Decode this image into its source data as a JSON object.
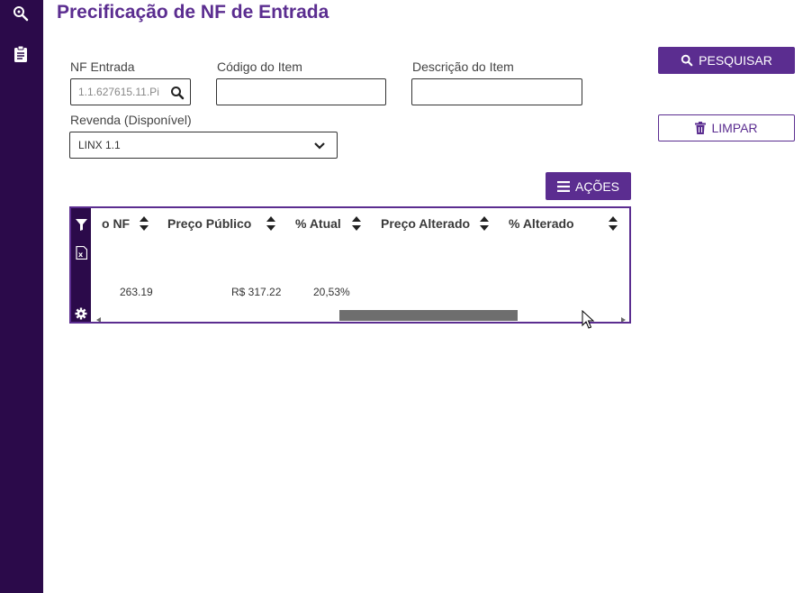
{
  "app": {
    "title": "Precificação de NF de Entrada",
    "colors": {
      "sidebar": "#2b0a4a",
      "accent": "#5b2d90"
    }
  },
  "sidebar": {
    "icons": [
      {
        "name": "search-icon"
      },
      {
        "name": "clipboard-icon"
      }
    ]
  },
  "filters": {
    "nf_entrada": {
      "label": "NF Entrada",
      "value": "1.1.627615.11.Pi"
    },
    "codigo_item": {
      "label": "Código do Item",
      "value": ""
    },
    "descricao_item": {
      "label": "Descrição do Item",
      "value": ""
    },
    "revenda": {
      "label": "Revenda (Disponível)",
      "selected": "LINX 1.1"
    }
  },
  "actions": {
    "pesquisar": "PESQUISAR",
    "limpar": "LIMPAR",
    "acoes": "AÇÕES"
  },
  "grid": {
    "columns": [
      "o NF",
      "Preço Público",
      "% Atual",
      "Preço Alterado",
      "% Alterado"
    ],
    "rows": [
      {
        "nf": "263.19",
        "preco_publico": "R$ 317.22",
        "pct_atual": "20,53%",
        "preco_alterado": "",
        "pct_alterado": ""
      }
    ],
    "horizontal_scroll_position": 0.7
  }
}
